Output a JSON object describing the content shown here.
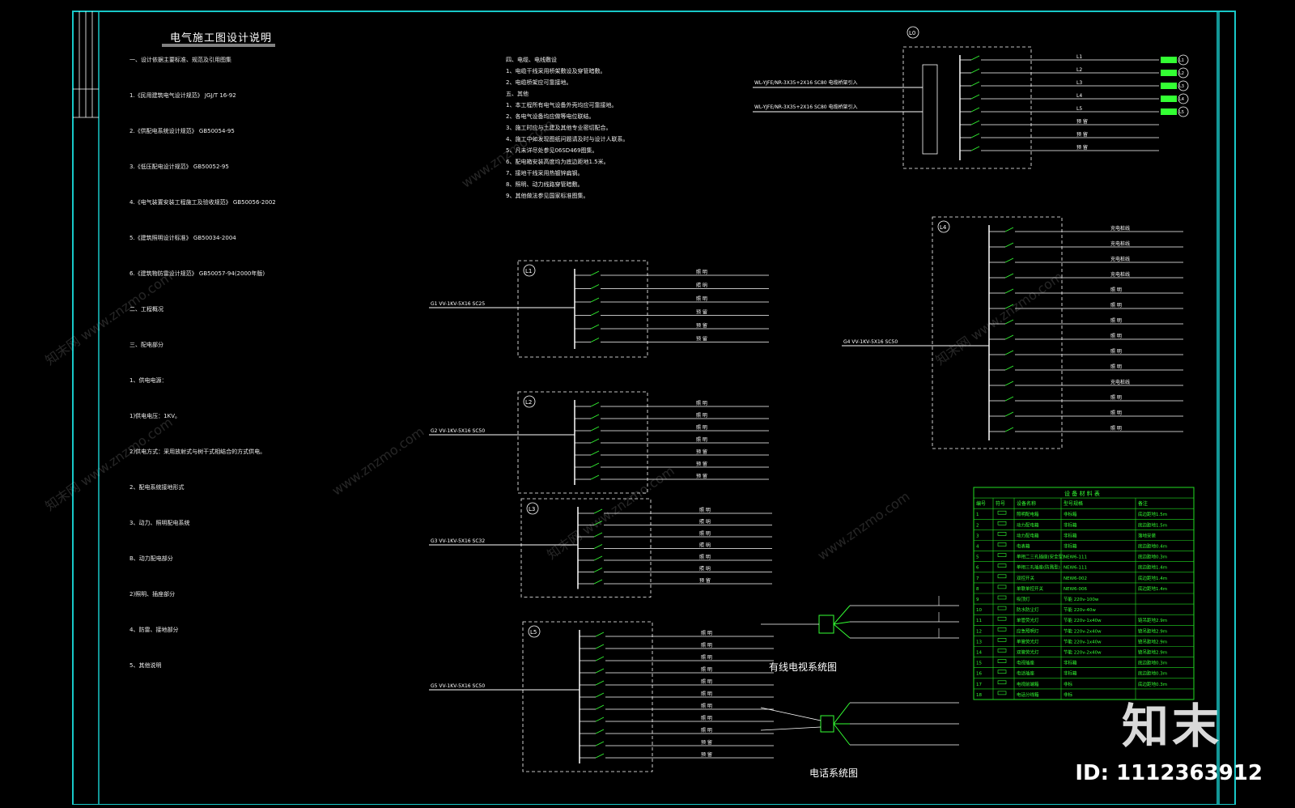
{
  "sheet": {
    "title": "电气施工图设计说明",
    "diagram_titles": {
      "cable_tv": "有线电视系统图",
      "telephone": "电话系统图"
    }
  },
  "notes_left": [
    "一、设计依据主要标准、规范及引用图集",
    "1.《民用建筑电气设计规范》  JGJ/T 16-92",
    "2.《供配电系统设计规范》  GB50054-95",
    "3.《低压配电设计规范》  GB50052-95",
    "4.《电气装置安装工程施工及验收规范》  GB50056-2002",
    "5.《建筑照明设计标准》  GB50034-2004",
    "6.《建筑物防雷设计规范》  GB50057-94(2000年版)",
    "二、工程概况",
    "三、配电部分",
    "1、供电电源：",
    "1)供电电压：1KV。",
    "2)供电方式：采用放射式与树干式相结合的方式供电。",
    "2、配电系统接地形式",
    "3、动力、照明配电系统",
    "B、动力配电部分",
    "2)照明、插座部分",
    "4、防雷、接地部分",
    "5、其他说明"
  ],
  "notes_mid": [
    "四、电缆、电线敷设",
    "1、电缆干线采用桥架敷设及穿管暗敷。",
    "2、电缆桥架应可靠接地。",
    "五、其他",
    "1、本工程所有电气设备外壳均应可靠接地。",
    "2、各电气设备均应做等电位联结。",
    "3、施工时应与土建及其他专业密切配合。",
    "4、施工中如发现图纸问题请及时与设计人联系。",
    "5、凡未详尽处参见06SD469图集。",
    "6、配电箱安装高度均为底边距地1.5米。",
    "7、接地干线采用热镀锌扁钢。",
    "8、照明、动力线路穿管暗敷。",
    "9、其他做法参见国家标准图集。"
  ],
  "panels": {
    "L1": {
      "label": "L1",
      "feeder": "G1 VV-1KV-5X16 SC25",
      "rows": [
        "照 明",
        "照 明",
        "照 明",
        "预 留",
        "预 留",
        "预 留"
      ]
    },
    "L2": {
      "label": "L2",
      "feeder": "G2 VV-1KV-5X16 SC50",
      "rows": [
        "照 明",
        "照 明",
        "照 明",
        "照 明",
        "预 留",
        "预 留",
        "预 留"
      ]
    },
    "L3": {
      "label": "L3",
      "feeder": "G3 VV-1KV-5X16 SC32",
      "rows": [
        "照 明",
        "照 明",
        "照 明",
        "照 明",
        "照 明",
        "照 明",
        "预 留"
      ]
    },
    "L4": {
      "label": "L4",
      "feeder": "G4 VV-1KV-5X16 SC50",
      "rows": [
        "充电桩线",
        "充电桩线",
        "充电桩线",
        "充电桩线",
        "照 明",
        "照 明",
        "照 明",
        "照 明",
        "照 明",
        "照 明",
        "充电桩线",
        "照 明",
        "照 明",
        "照 明"
      ]
    },
    "L5": {
      "label": "L5",
      "feeder": "G5 VV-1KV-5X16 SC50",
      "rows": [
        "照 明",
        "照 明",
        "照 明",
        "照 明",
        "照 明",
        "照 明",
        "照 明",
        "照 明",
        "照 明",
        "预 留",
        "预 留"
      ]
    },
    "L0": {
      "label": "L0",
      "feeder1": "WL-YJFE/NR-3X35+2X16 SC80 电缆桥架引入",
      "feeder2": "WL-YJFE/NR-3X35+2X16 SC80 电缆桥架引入",
      "rows": [
        "L1",
        "L2",
        "L3",
        "L4",
        "L5",
        "预 留",
        "预 留",
        "预 留"
      ]
    }
  },
  "circle_tags": [
    "L1",
    "L2",
    "L3",
    "L4",
    "L5"
  ],
  "equipment_table": {
    "title": "设 备 材 料 表",
    "headers": [
      "编号",
      "符号",
      "设备名称",
      "型号规格",
      "备注"
    ],
    "rows": [
      [
        "1",
        "",
        "照明配电箱",
        "非标箱",
        "底边距地1.5m"
      ],
      [
        "2",
        "",
        "动力配电箱",
        "非标箱",
        "底边距地1.5m"
      ],
      [
        "3",
        "",
        "动力配电箱",
        "非标箱",
        "落地安装"
      ],
      [
        "4",
        "",
        "电表箱",
        "非标箱",
        "底边距地0.4m"
      ],
      [
        "5",
        "",
        "单相二三孔插座(安全型)",
        "NEW6-111",
        "底边距地0.3m"
      ],
      [
        "6",
        "",
        "单相三孔插座(防溅型)",
        "NEW6-111",
        "底边距地1.4m"
      ],
      [
        "7",
        "",
        "双控开关",
        "NEW6-002",
        "底边距地1.4m"
      ],
      [
        "8",
        "",
        "单联单控开关",
        "NEW6-006",
        "底边距地1.4m"
      ],
      [
        "9",
        "",
        "吸顶灯",
        "节能 220v-100w",
        ""
      ],
      [
        "10",
        "",
        "防水防尘灯",
        "节能 220v-40w",
        ""
      ],
      [
        "11",
        "",
        "单管荧光灯",
        "节能 220v-1x40w",
        "链吊距地2.9m"
      ],
      [
        "12",
        "",
        "应急照明灯",
        "节能 220v-2x40w",
        "链吊距地2.9m"
      ],
      [
        "13",
        "",
        "单管荧光灯",
        "节能 220v-1x40w",
        "链吊距地2.9m"
      ],
      [
        "14",
        "",
        "双管荧光灯",
        "节能 220v-2x40w",
        "链吊距地2.9m"
      ],
      [
        "15",
        "",
        "电视插座",
        "非标箱",
        "底边距地0.3m"
      ],
      [
        "16",
        "",
        "电话插座",
        "非标箱",
        "底边距地0.3m"
      ],
      [
        "17",
        "",
        "电视前端箱",
        "非标",
        "底边距地0.3m"
      ],
      [
        "18",
        "",
        "电话分线箱",
        "非标",
        ""
      ]
    ]
  },
  "watermark": {
    "logo": "知末",
    "id": "ID: 1112363912",
    "tile_texts": [
      "知末网 www.znzmo.com",
      "www.znzmo.com"
    ]
  },
  "colors": {
    "background": "#000000",
    "border": "#18c8c8",
    "line": "#ffffff",
    "table": "#22dd22",
    "accent": "#33ff33"
  }
}
